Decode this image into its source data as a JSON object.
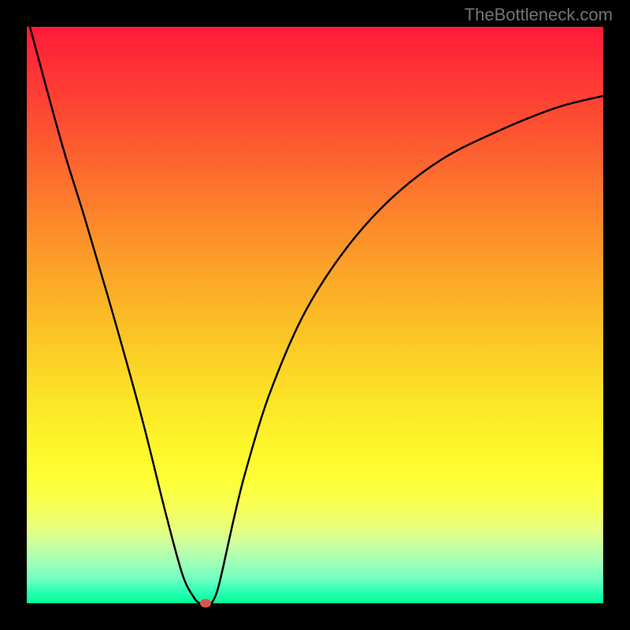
{
  "watermark": "TheBottleneck.com",
  "chart_data": {
    "type": "line",
    "title": "",
    "xlabel": "",
    "ylabel": "",
    "xlim": [
      0,
      100
    ],
    "ylim": [
      0,
      100
    ],
    "series": [
      {
        "name": "bottleneck-curve",
        "x": [
          0,
          6,
          10,
          15,
          20,
          24,
          27,
          29,
          30,
          31,
          32,
          33,
          34,
          36,
          38,
          42,
          48,
          55,
          63,
          72,
          82,
          92,
          100
        ],
        "values": [
          102,
          80,
          67,
          50,
          32,
          16,
          5,
          1,
          0,
          0,
          0,
          2,
          6,
          15,
          23,
          36,
          50,
          61,
          70,
          77,
          82,
          86,
          88
        ]
      }
    ],
    "marker": {
      "x": 31,
      "y": 0
    },
    "gradient_colors": {
      "top": "#ff1a3a",
      "mid": "#fbcc26",
      "bottom": "#00ff99"
    }
  }
}
